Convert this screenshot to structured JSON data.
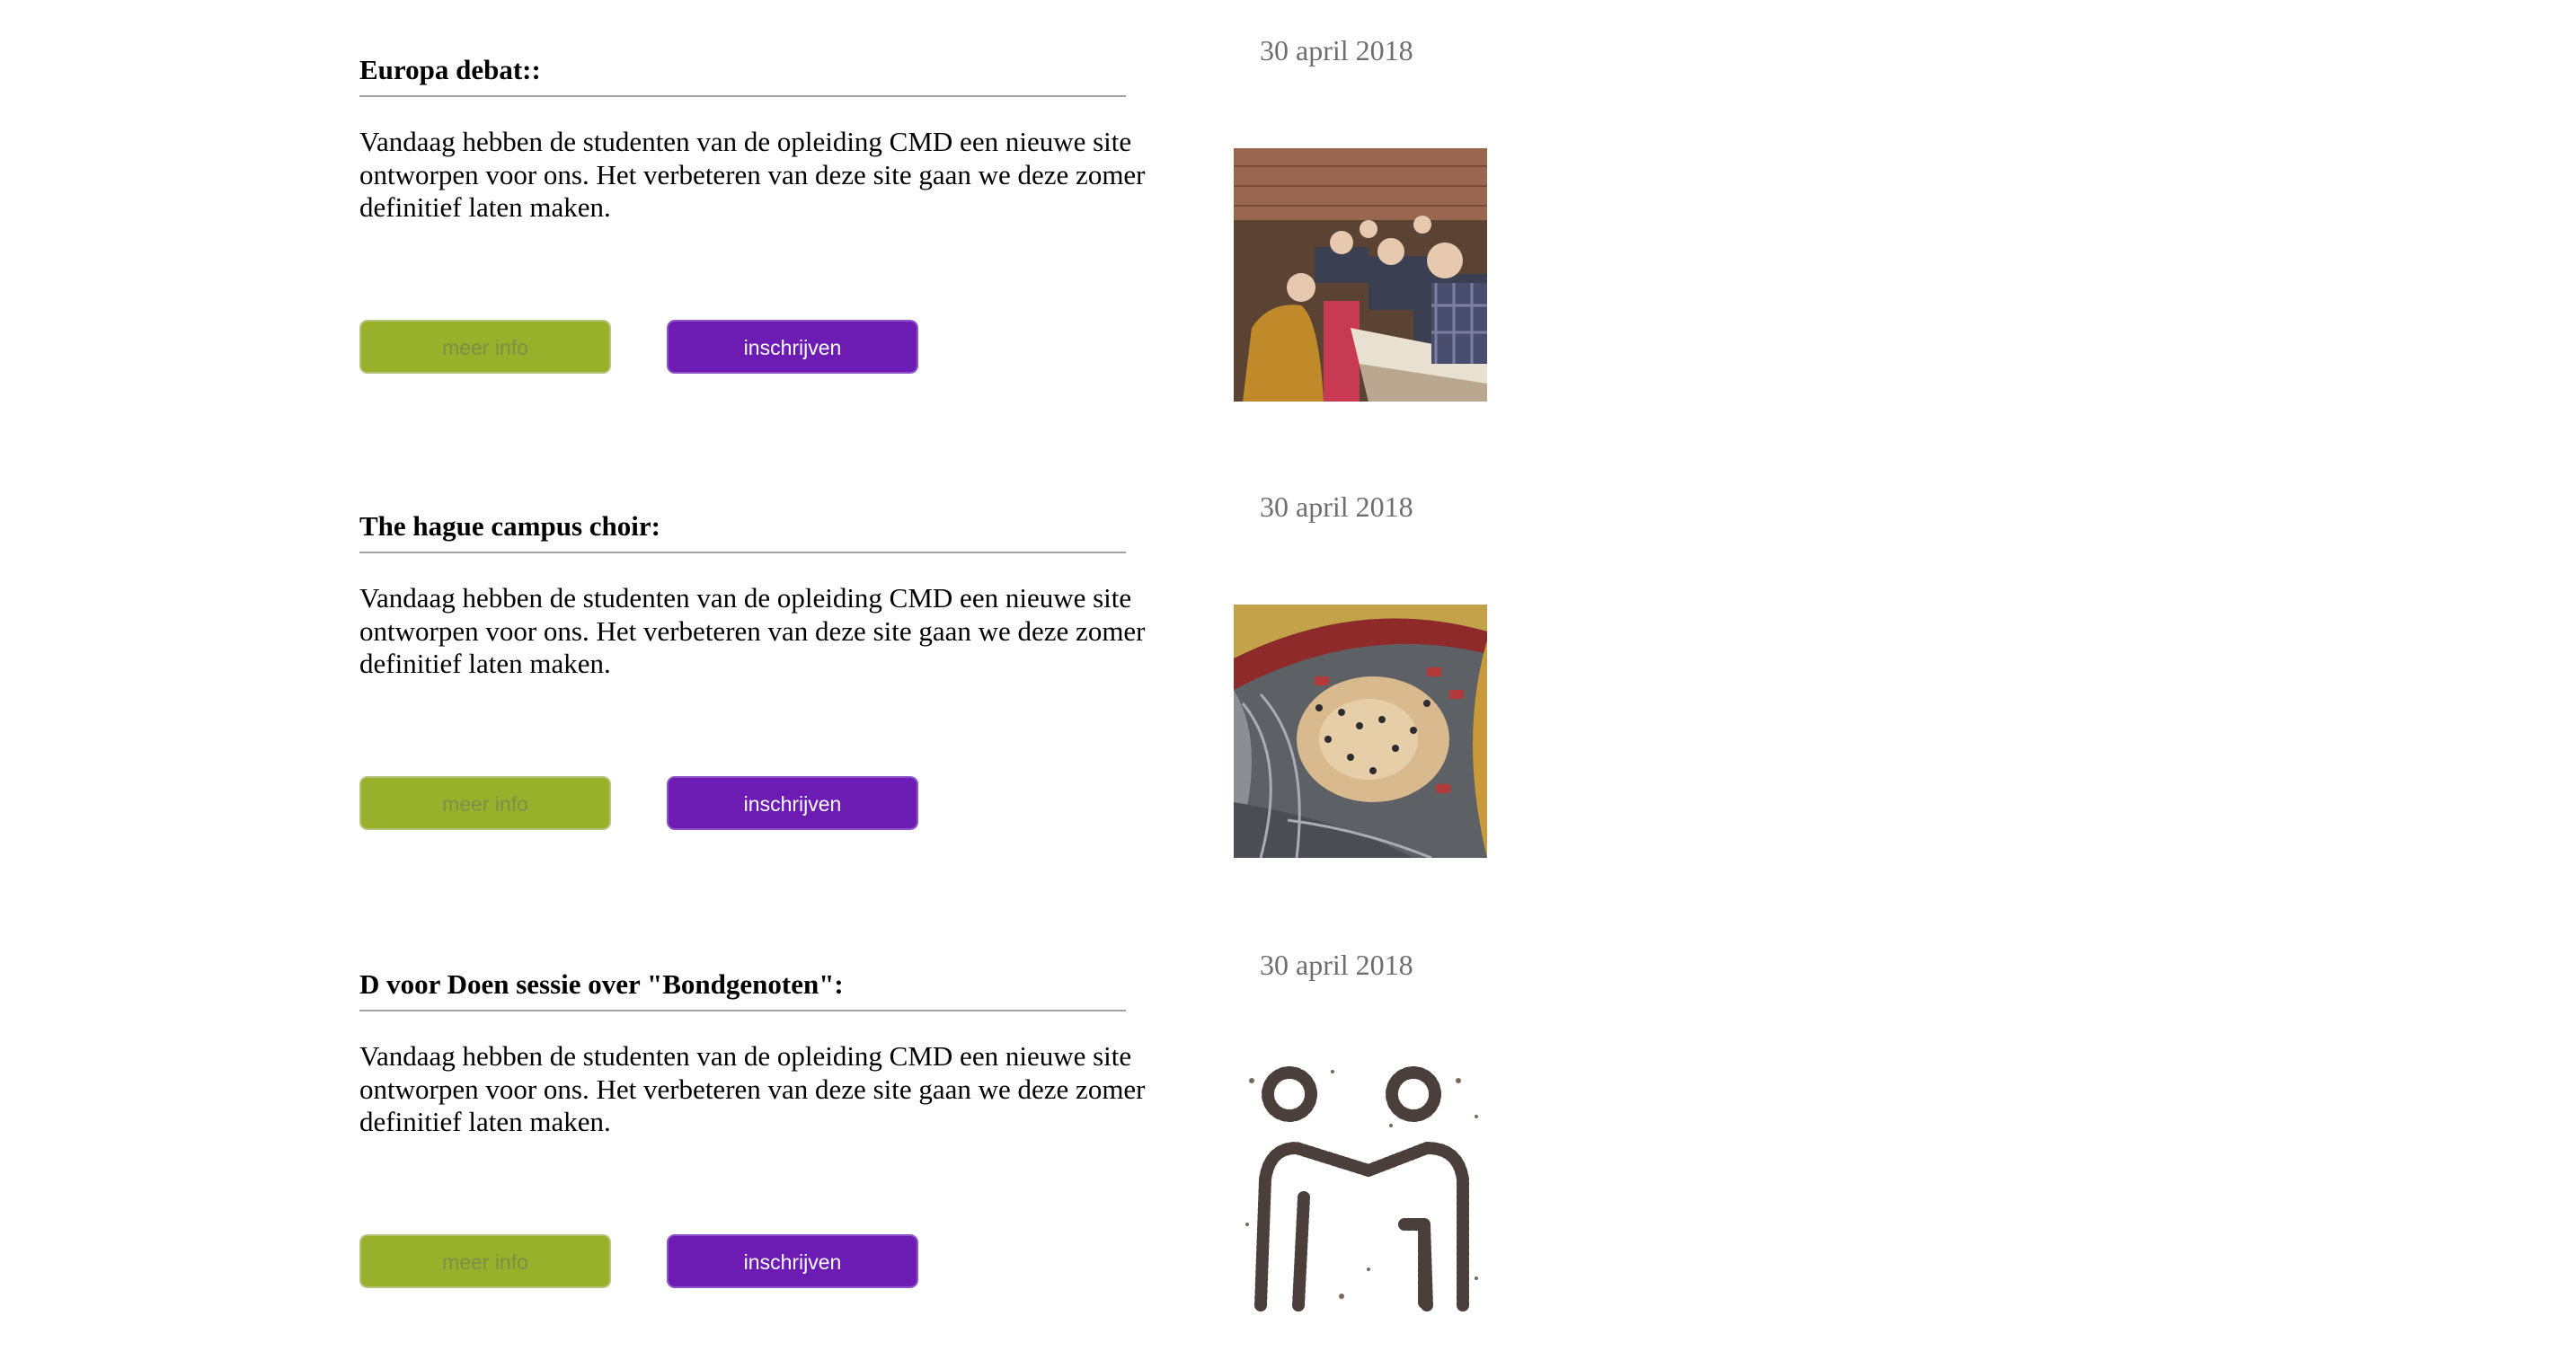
{
  "events": [
    {
      "title": "Europa debat::",
      "description": "Vandaag hebben de studenten van de opleiding CMD een nieuwe site ontworpen voor ons. Het verbeteren van deze site gaan we deze zomer definitief laten maken.",
      "more_info_label": "meer info",
      "signup_label": "inschrijven",
      "date": "30 april 2018",
      "image": "lecture-audience-photo"
    },
    {
      "title": "The hague campus choir:",
      "description": "Vandaag hebben de studenten van de opleiding CMD een nieuwe site ontworpen voor ons. Het verbeteren van deze site gaan we deze zomer definitief laten maken.",
      "more_info_label": "meer info",
      "signup_label": "inschrijven",
      "date": "30 april 2018",
      "image": "campus-atrium-aerial-photo"
    },
    {
      "title": "D voor Doen sessie over \"Bondgenoten\":",
      "description": "Vandaag hebben de studenten van de opleiding CMD een nieuwe site ontworpen voor ons. Het verbeteren van deze site gaan we deze zomer definitief laten maken.",
      "more_info_label": "meer info",
      "signup_label": "inschrijven",
      "date": "30 april 2018",
      "image": "crowd-handshake-figures-photo"
    }
  ],
  "colors": {
    "more_info_button": "#99b02a",
    "signup_button": "#6c1cb3",
    "date_text": "#6e6e6e",
    "divider": "#a0a0a0"
  }
}
